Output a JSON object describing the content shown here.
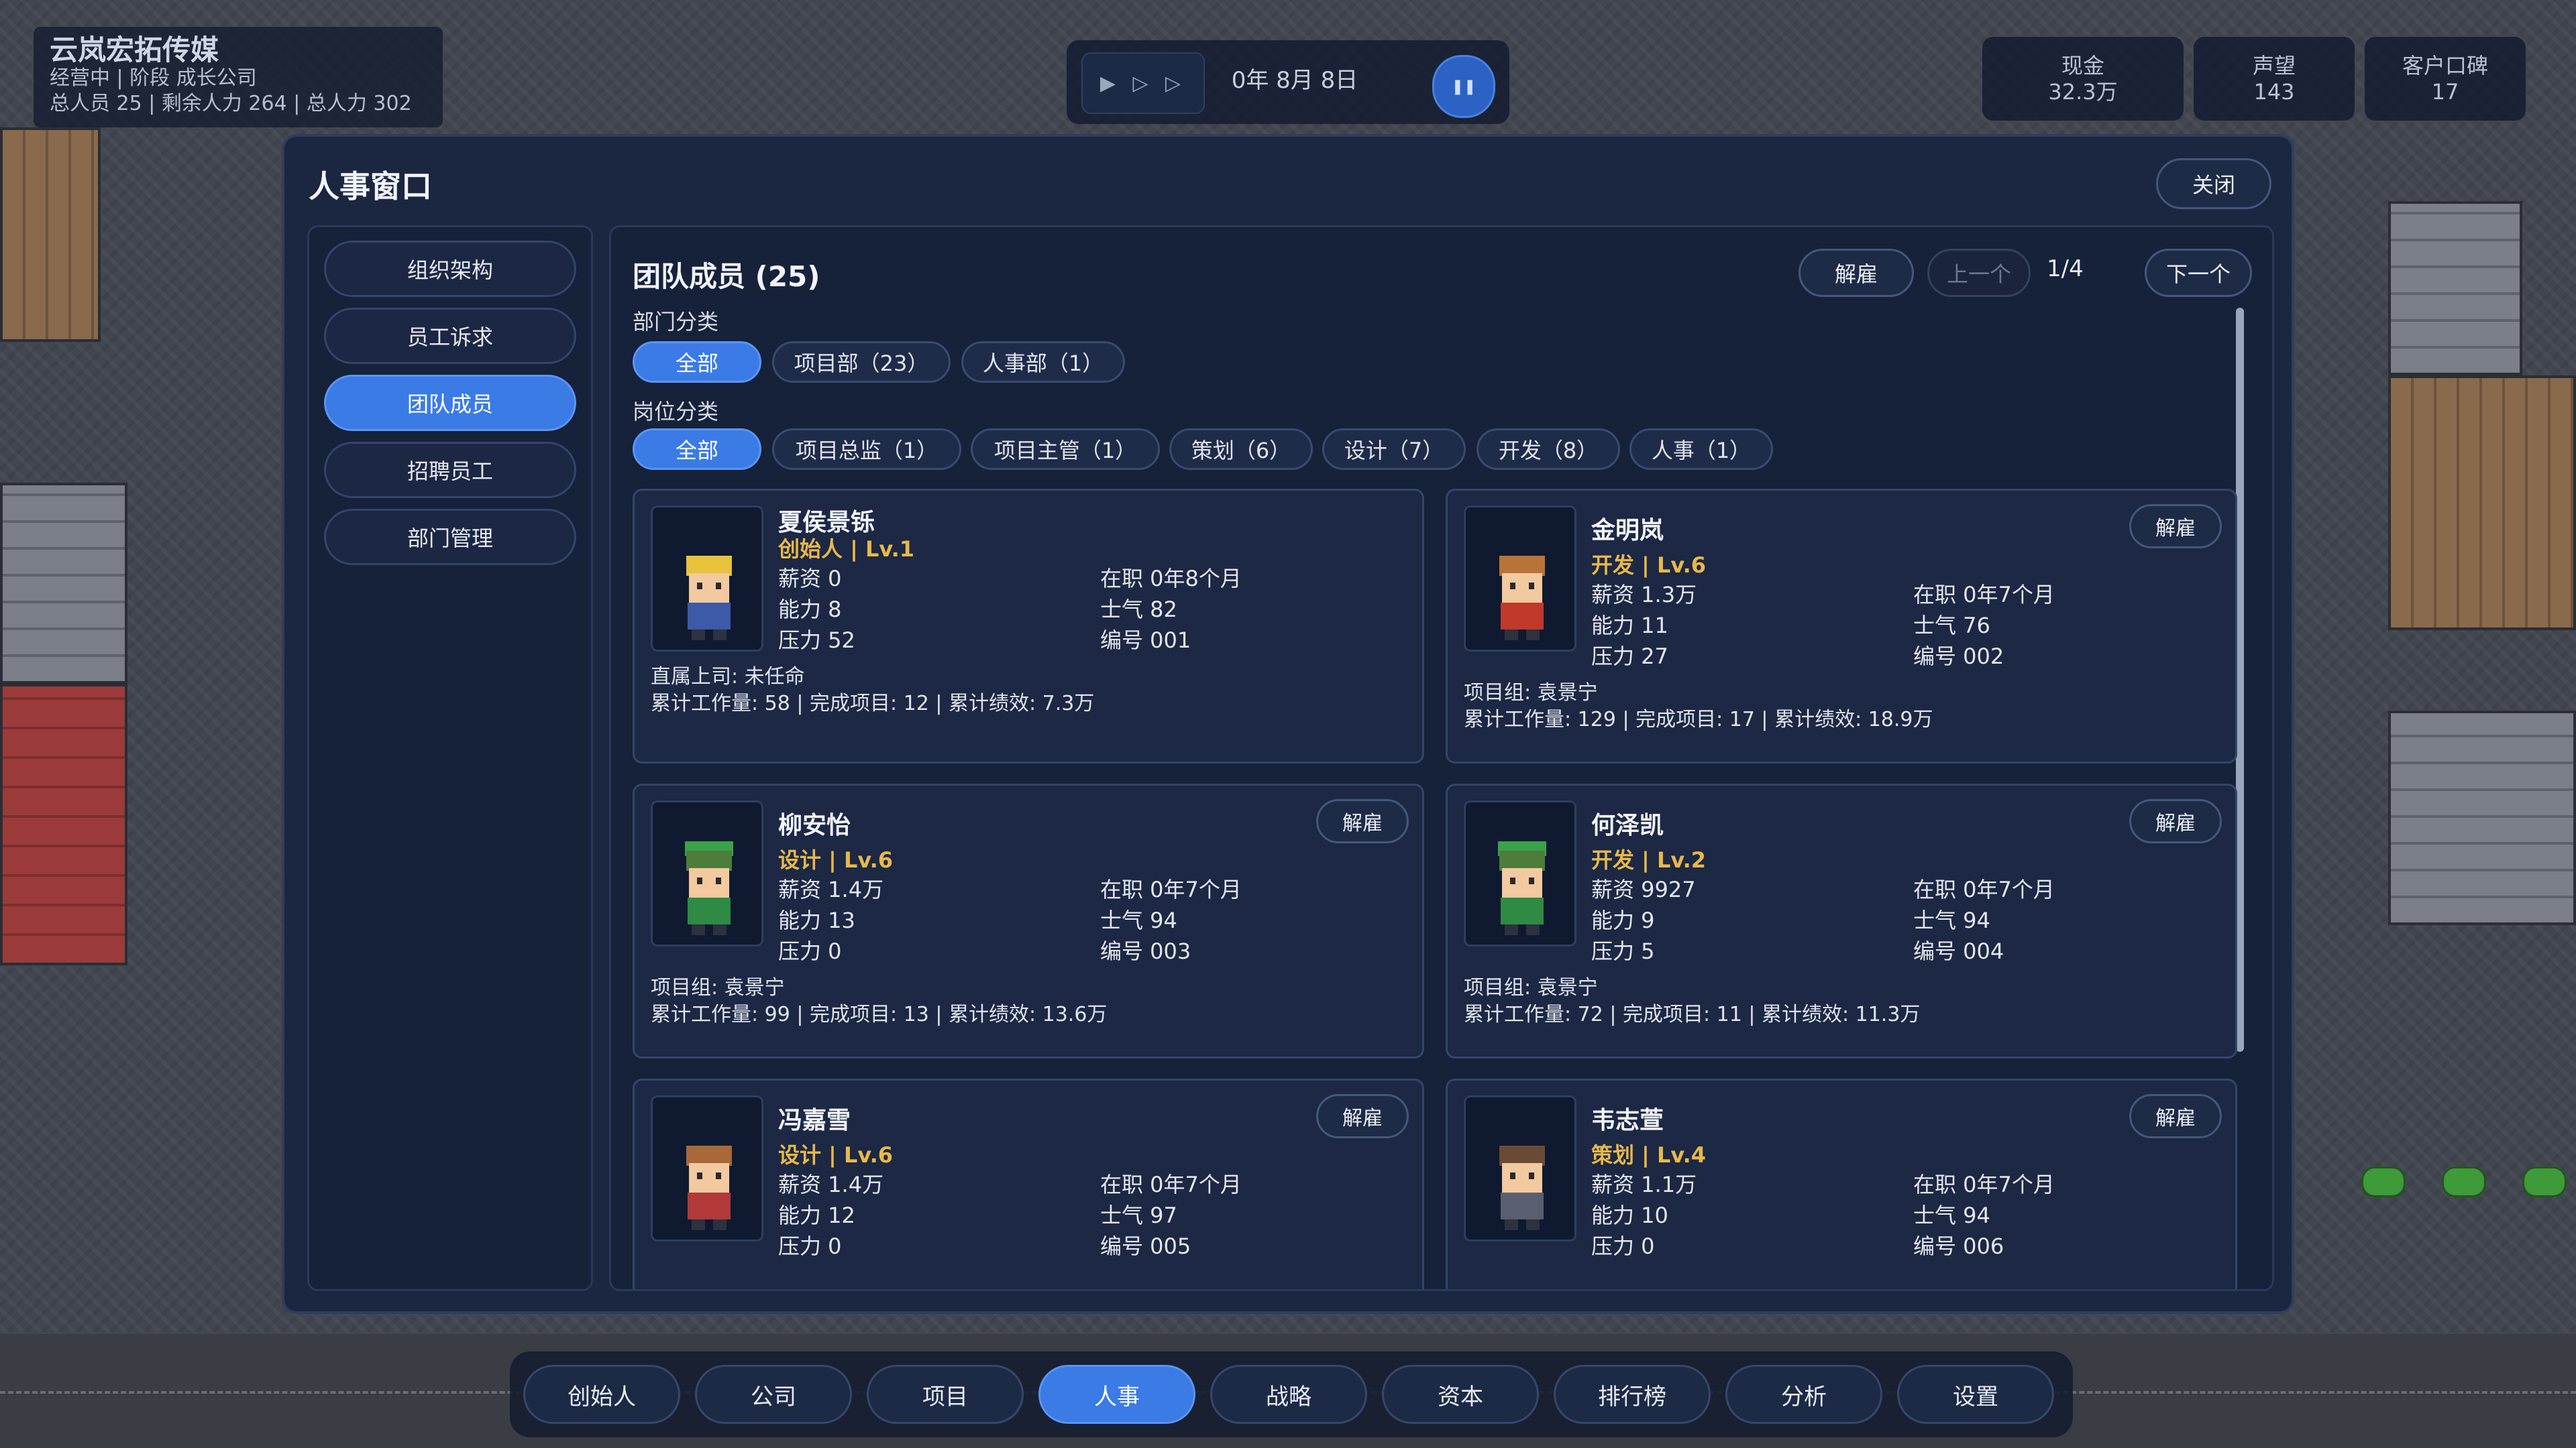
{
  "hud": {
    "company": "云岚宏拓传媒",
    "status_line": "经营中 | 阶段 成长公司",
    "staff_line": "总人员 25 | 剩余人力 264 | 总人力 302",
    "speed_icon": "▶ ▷ ▷",
    "date": "0年 8月 8日",
    "pause_icon": "❚❚",
    "stats": [
      {
        "label": "现金",
        "value": "32.3万"
      },
      {
        "label": "声望",
        "value": "143"
      },
      {
        "label": "客户口碑",
        "value": "17"
      }
    ]
  },
  "window": {
    "title": "人事窗口",
    "close_label": "关闭"
  },
  "sidebar": {
    "items": [
      {
        "label": "组织架构",
        "active": false
      },
      {
        "label": "员工诉求",
        "active": false
      },
      {
        "label": "团队成员",
        "active": true
      },
      {
        "label": "招聘员工",
        "active": false
      },
      {
        "label": "部门管理",
        "active": false
      }
    ]
  },
  "team": {
    "title": "团队成员 (25)",
    "fire_label": "解雇",
    "prev_label": "上一个",
    "page": "1/4",
    "next_label": "下一个",
    "dept_label": "部门分类",
    "dept_chips": [
      "全部",
      "项目部（23）",
      "人事部（1）"
    ],
    "role_label": "岗位分类",
    "role_chips": [
      "全部",
      "项目总监（1）",
      "项目主管（1）",
      "策划（6）",
      "设计（7）",
      "开发（8）",
      "人事（1）"
    ]
  },
  "members": [
    {
      "name": "夏侯景铄",
      "role": "创始人 | Lv.1",
      "salary": "薪资 0",
      "ability": "能力 8",
      "pressure": "压力 52",
      "tenure": "在职  0年8个月",
      "morale": "士气  82",
      "id": "编号  001",
      "line1": "直属上司: 未任命",
      "line2": "累计工作量: 58 | 完成项目: 12 | 累计绩效: 7.3万",
      "fire": false,
      "hair": "#e8c23a",
      "shirt": "#3c5aa8",
      "hat": ""
    },
    {
      "name": "金明岚",
      "role": "开发 | Lv.6",
      "salary": "薪资 1.3万",
      "ability": "能力 11",
      "pressure": "压力 27",
      "tenure": "在职  0年7个月",
      "morale": "士气  76",
      "id": "编号  002",
      "line1": "项目组: 袁景宁",
      "line2": "累计工作量: 129 | 完成项目: 17 | 累计绩效: 18.9万",
      "fire": true,
      "hair": "#b8733a",
      "shirt": "#c0392b",
      "hat": ""
    },
    {
      "name": "柳安怡",
      "role": "设计 | Lv.6",
      "salary": "薪资 1.4万",
      "ability": "能力 13",
      "pressure": "压力 0",
      "tenure": "在职  0年7个月",
      "morale": "士气  94",
      "id": "编号  003",
      "line1": "项目组: 袁景宁",
      "line2": "累计工作量: 99 | 完成项目: 13 | 累计绩效: 13.6万",
      "fire": true,
      "hair": "#4d7d3a",
      "shirt": "#2f8a44",
      "hat": "#3aa24a"
    },
    {
      "name": "何泽凯",
      "role": "开发 | Lv.2",
      "salary": "薪资 9927",
      "ability": "能力 9",
      "pressure": "压力 5",
      "tenure": "在职  0年7个月",
      "morale": "士气  94",
      "id": "编号  004",
      "line1": "项目组: 袁景宁",
      "line2": "累计工作量: 72 | 完成项目: 11 | 累计绩效: 11.3万",
      "fire": true,
      "hair": "#4d7d3a",
      "shirt": "#2f8a44",
      "hat": "#3aa24a"
    },
    {
      "name": "冯嘉雪",
      "role": "设计 | Lv.6",
      "salary": "薪资 1.4万",
      "ability": "能力 12",
      "pressure": "压力 0",
      "tenure": "在职  0年7个月",
      "morale": "士气  97",
      "id": "编号  005",
      "line1": "",
      "line2": "",
      "fire": true,
      "hair": "#a8683a",
      "shirt": "#b23a3a",
      "hat": ""
    },
    {
      "name": "韦志萱",
      "role": "策划 | Lv.4",
      "salary": "薪资 1.1万",
      "ability": "能力 10",
      "pressure": "压力 0",
      "tenure": "在职  0年7个月",
      "morale": "士气  94",
      "id": "编号  006",
      "line1": "",
      "line2": "",
      "fire": true,
      "hair": "#6b4a35",
      "shirt": "#5a5f70",
      "hat": ""
    }
  ],
  "bottom_nav": [
    {
      "label": "创始人",
      "active": false
    },
    {
      "label": "公司",
      "active": false
    },
    {
      "label": "项目",
      "active": false
    },
    {
      "label": "人事",
      "active": true
    },
    {
      "label": "战略",
      "active": false
    },
    {
      "label": "资本",
      "active": false
    },
    {
      "label": "排行榜",
      "active": false
    },
    {
      "label": "分析",
      "active": false
    },
    {
      "label": "设置",
      "active": false
    }
  ]
}
